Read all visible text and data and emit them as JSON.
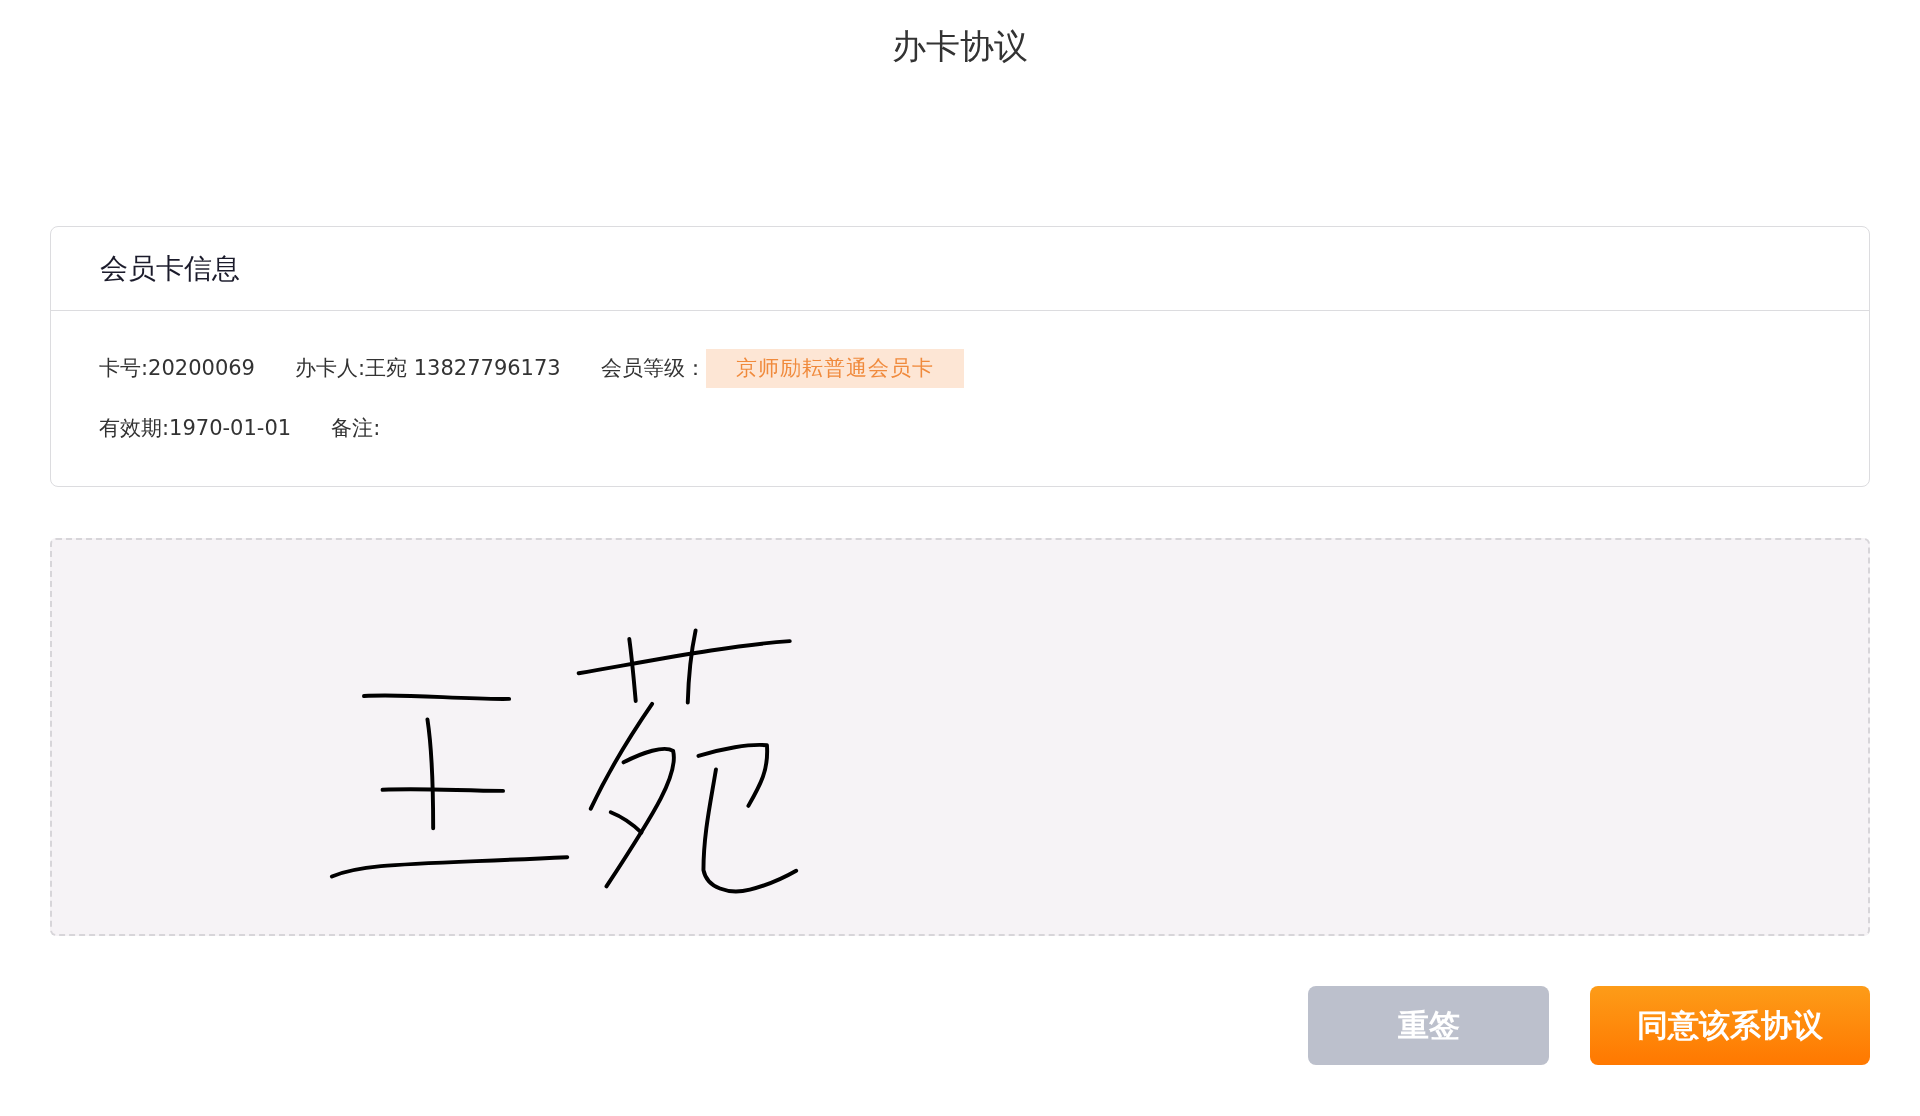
{
  "page": {
    "title": "办卡协议"
  },
  "member_card": {
    "heading": "会员卡信息",
    "rows": [
      {
        "items": [
          {
            "kind": "text",
            "text": "卡号:20200069"
          },
          {
            "kind": "text",
            "text": "办卡人:王宛 13827796173"
          },
          {
            "kind": "tag",
            "label": "会员等级：",
            "tag": "京师励耘普通会员卡"
          }
        ]
      },
      {
        "items": [
          {
            "kind": "text",
            "text": "有效期:1970-01-01"
          },
          {
            "kind": "text",
            "text": "备注:"
          }
        ]
      }
    ]
  },
  "signature_pad": {
    "signed": true
  },
  "buttons": [
    {
      "kind": "secondary",
      "label": "重签"
    },
    {
      "kind": "primary",
      "label": "同意该系协议"
    }
  ]
}
